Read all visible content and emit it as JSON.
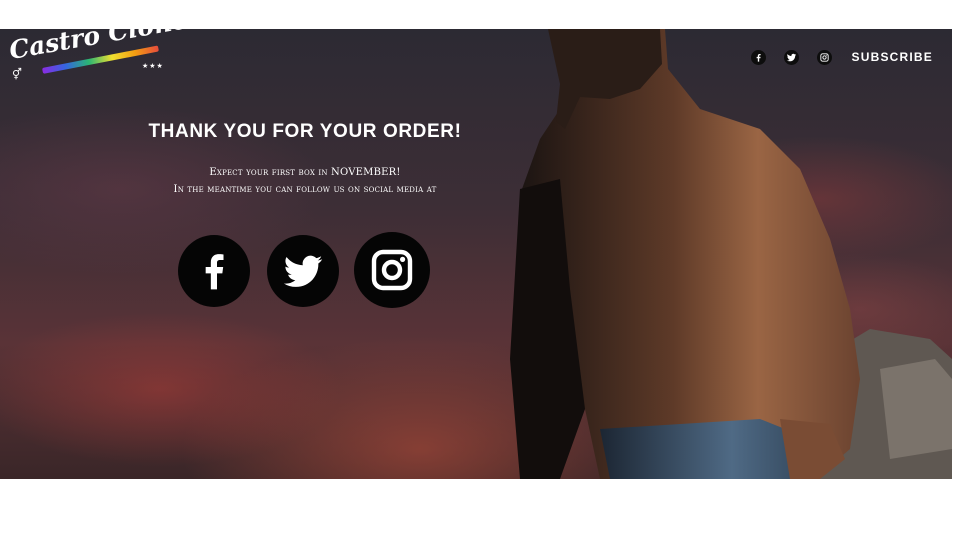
{
  "brand": {
    "name": "Castro Clone",
    "stars": "★★★"
  },
  "nav": {
    "icons": [
      "facebook-icon",
      "twitter-icon",
      "instagram-icon"
    ],
    "subscribe_label": "SUBSCRIBE"
  },
  "confirmation": {
    "headline": "THANK YOU FOR YOUR ORDER!",
    "line1": "Expect your first box in NOVEMBER!",
    "line2": "In the meantime you can follow us on social media at"
  },
  "social_links": [
    {
      "name": "facebook",
      "icon": "facebook-icon"
    },
    {
      "name": "twitter",
      "icon": "twitter-icon"
    },
    {
      "name": "instagram",
      "icon": "instagram-icon"
    }
  ],
  "colors": {
    "icon_background": "#050505",
    "text": "#ffffff",
    "logo_stripe": [
      "#8a2be2",
      "#3466e0",
      "#2bb673",
      "#f0e030",
      "#f39c12",
      "#e74c3c"
    ]
  }
}
